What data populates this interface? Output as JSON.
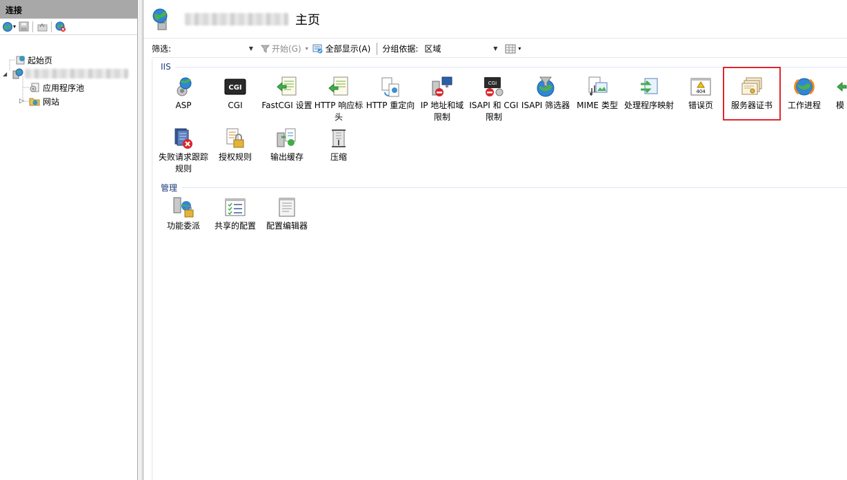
{
  "left_pane": {
    "title": "连接",
    "tree": {
      "start_page": "起始页",
      "app_pools": "应用程序池",
      "sites": "网站"
    }
  },
  "header": {
    "title": "主页"
  },
  "filter_bar": {
    "filter_label": "筛选:",
    "filter_value": "",
    "go_label": "开始(G)",
    "show_all_label": "全部显示(A)",
    "group_by_label": "分组依据:",
    "group_by_value": "区域"
  },
  "groups": {
    "iis": {
      "title": "IIS",
      "items": [
        {
          "label": "ASP",
          "icon": "asp-icon"
        },
        {
          "label": "CGI",
          "icon": "cgi-icon"
        },
        {
          "label": "FastCGI 设置",
          "icon": "fastcgi-icon"
        },
        {
          "label": "HTTP 响应标头",
          "icon": "http-response-headers-icon"
        },
        {
          "label": "HTTP 重定向",
          "icon": "http-redirect-icon"
        },
        {
          "label": "IP 地址和域限制",
          "icon": "ip-restrictions-icon"
        },
        {
          "label": "ISAPI 和 CGI 限制",
          "icon": "isapi-cgi-restrictions-icon"
        },
        {
          "label": "ISAPI 筛选器",
          "icon": "isapi-filters-icon"
        },
        {
          "label": "MIME 类型",
          "icon": "mime-types-icon"
        },
        {
          "label": "处理程序映射",
          "icon": "handler-mappings-icon"
        },
        {
          "label": "错误页",
          "icon": "error-pages-icon"
        },
        {
          "label": "服务器证书",
          "icon": "server-certificates-icon"
        },
        {
          "label": "工作进程",
          "icon": "worker-processes-icon"
        },
        {
          "label": "模",
          "icon": "modules-icon"
        },
        {
          "label": "失败请求跟踪规则",
          "icon": "failed-request-tracing-icon"
        },
        {
          "label": "授权规则",
          "icon": "authorization-rules-icon"
        },
        {
          "label": "输出缓存",
          "icon": "output-caching-icon"
        },
        {
          "label": "压缩",
          "icon": "compression-icon"
        }
      ]
    },
    "management": {
      "title": "管理",
      "items": [
        {
          "label": "功能委派",
          "icon": "feature-delegation-icon"
        },
        {
          "label": "共享的配置",
          "icon": "shared-configuration-icon"
        },
        {
          "label": "配置编辑器",
          "icon": "configuration-editor-icon"
        }
      ]
    }
  },
  "colors": {
    "selection_outline": "#e0252b",
    "group_header_text": "#1e3a7a",
    "left_title_bg": "#a8a8a8"
  }
}
